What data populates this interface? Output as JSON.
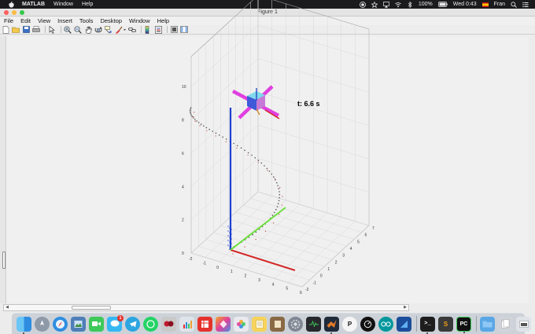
{
  "menubar": {
    "app_name": "MATLAB",
    "items": [
      "Window",
      "Help"
    ],
    "battery": "100%",
    "clock": "Wed 0:43",
    "user": "Fran"
  },
  "window": {
    "title": "Figure 1"
  },
  "figure_menu": {
    "items": [
      "File",
      "Edit",
      "View",
      "Insert",
      "Tools",
      "Desktop",
      "Window",
      "Help"
    ]
  },
  "toolbar": {
    "icons": [
      "new-figure-icon",
      "open-file-icon",
      "save-icon",
      "print-icon",
      "edit-plot-arrow-icon",
      "zoom-in-icon",
      "zoom-out-icon",
      "pan-hand-icon",
      "rotate-3d-icon",
      "data-cursor-icon",
      "brush-icon",
      "link-plot-icon",
      "insert-colorbar-icon",
      "insert-legend-icon",
      "hide-plot-tools-icon",
      "show-plot-tools-icon"
    ]
  },
  "plot": {
    "annotation": "t: 6.6 s",
    "z_ticks": [
      "0",
      "2",
      "4",
      "6",
      "8",
      "10"
    ],
    "x_ticks": [
      "-2",
      "-1",
      "0",
      "1",
      "2",
      "3",
      "4",
      "5",
      "6"
    ],
    "y_ticks": [
      "-2",
      "-1",
      "0",
      "1",
      "2",
      "3",
      "4",
      "5",
      "6",
      "7"
    ],
    "colors": {
      "z_axis": "#1f3fd0",
      "x_axis": "#d42a2a",
      "y_axis": "#6ae03a",
      "rotor_arms": "#e040e0",
      "trajectory": "#555555"
    }
  },
  "dock": {
    "mail_badge": "1",
    "apps": [
      "finder-icon",
      "launchpad-icon",
      "safari-icon",
      "preview-icon",
      "facetime-icon",
      "messages-icon",
      "telegram-icon",
      "whatsapp-icon",
      "photo-booth-icon",
      "keynote-icon",
      "numbers-icon",
      "pages-icon",
      "photos-icon",
      "notes-icon",
      "system-preferences-icon",
      "matlab-icon",
      "terminal-icon",
      "sublime-text-icon",
      "pycharm-icon",
      "folder-icon",
      "documents-icon",
      "downloads-icon",
      "trash-icon"
    ]
  }
}
